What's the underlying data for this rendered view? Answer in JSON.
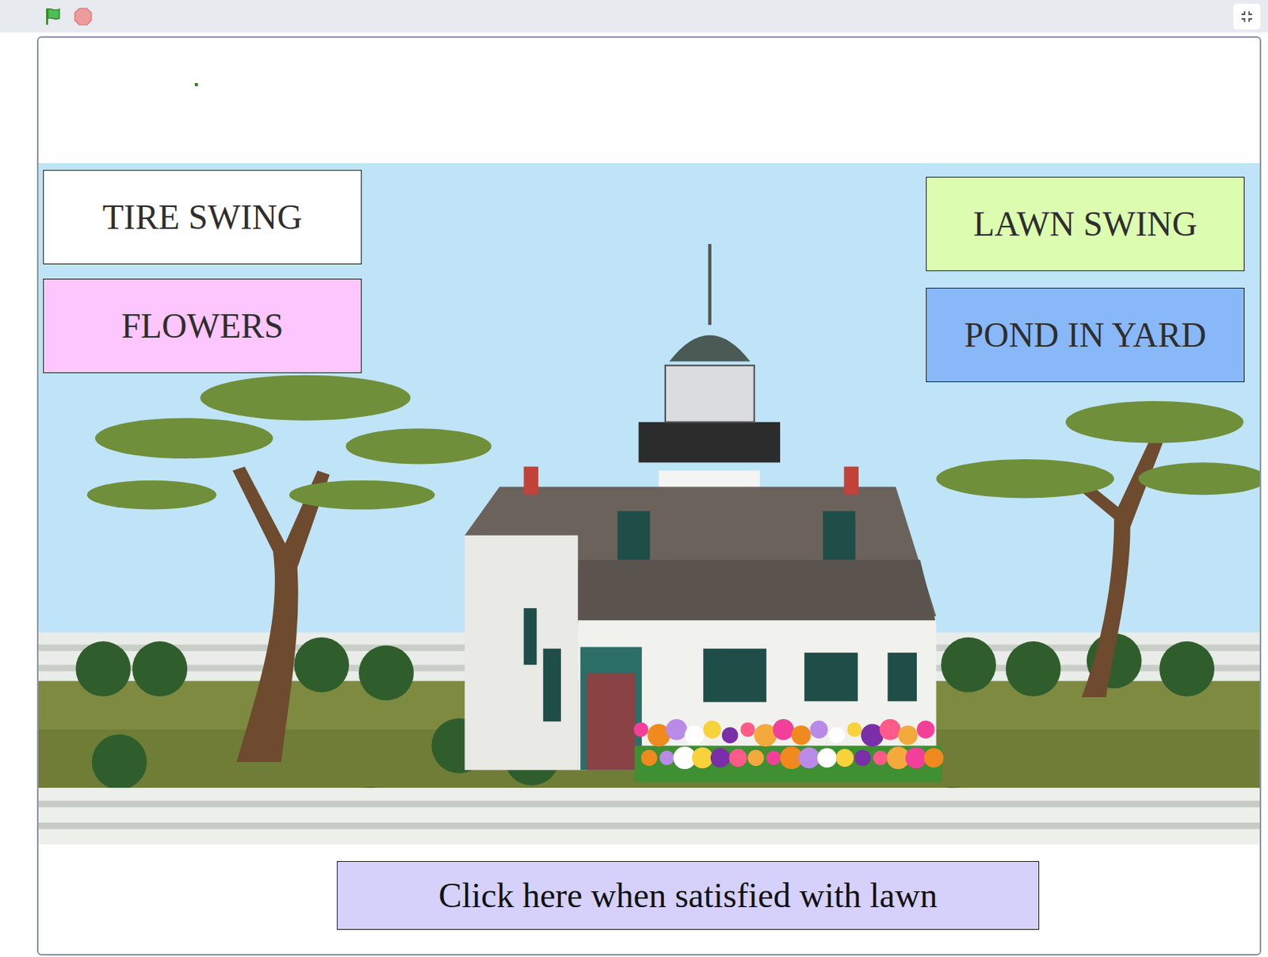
{
  "stage": {
    "buttons": [
      {
        "label": "TIRE SWING",
        "color": "#ffffff"
      },
      {
        "label": "FLOWERS",
        "color": "#fec6fe"
      },
      {
        "label": "LAWN SWING",
        "color": "#dcfcb0"
      },
      {
        "label": "POND IN YARD",
        "color": "#89b8f9"
      }
    ],
    "done_button": {
      "label": "Click here when satisfied with lawn",
      "color": "#d5d1fb"
    }
  }
}
